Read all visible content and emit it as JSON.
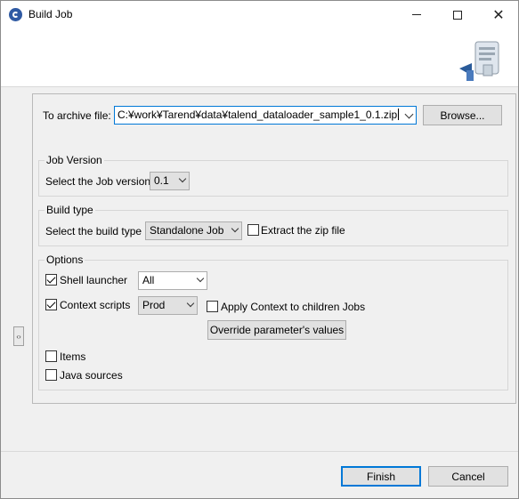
{
  "window": {
    "title": "Build Job",
    "minimize_label": "",
    "close_glyph": "✕"
  },
  "archive": {
    "label": "To archive file:",
    "value": "C:¥work¥Tarend¥data¥talend_dataloader_sample1_0.1.zip",
    "browse_label": "Browse..."
  },
  "job_version": {
    "group_title": "Job Version",
    "label": "Select the Job version",
    "selected": "0.1"
  },
  "build_type": {
    "group_title": "Build type",
    "label": "Select the build type",
    "selected": "Standalone Job",
    "extract_label": "Extract the zip file",
    "extract_checked": false
  },
  "options": {
    "group_title": "Options",
    "shell_launcher_label": "Shell launcher",
    "shell_launcher_checked": true,
    "shell_launcher_selected": "All",
    "context_scripts_label": "Context scripts",
    "context_scripts_checked": true,
    "context_selected": "Prod",
    "apply_context_label": "Apply Context to children Jobs",
    "apply_context_checked": false,
    "override_label": "Override parameter's values",
    "items_label": "Items",
    "items_checked": false,
    "java_sources_label": "Java sources",
    "java_sources_checked": false
  },
  "footer": {
    "finish_label": "Finish",
    "cancel_label": "Cancel"
  },
  "icons": {
    "app": "talend-icon",
    "banner": "export-job-icon",
    "collapse": "collapse-arrows-icon"
  }
}
